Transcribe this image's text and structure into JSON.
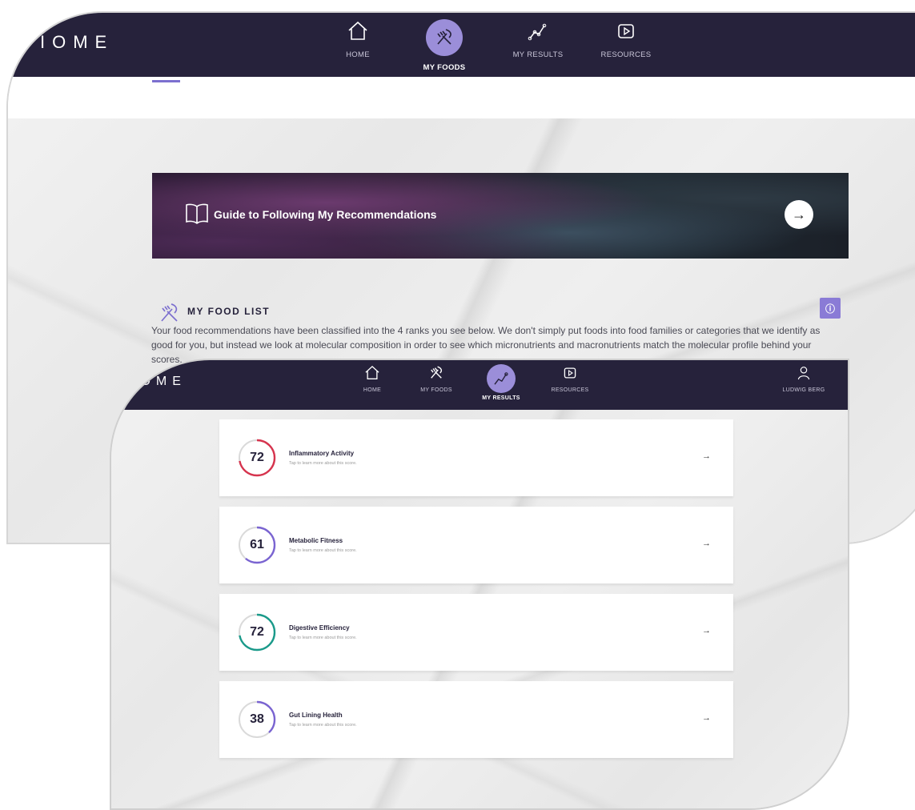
{
  "back_app": {
    "logo": "IOME",
    "nav": [
      {
        "label": "HOME",
        "icon": "home-icon",
        "active": false
      },
      {
        "label": "MY FOODS",
        "icon": "utensils-icon",
        "active": true
      },
      {
        "label": "MY RESULTS",
        "icon": "results-chart-icon",
        "active": false
      },
      {
        "label": "RESOURCES",
        "icon": "play-icon",
        "active": false
      }
    ],
    "banner": {
      "title": "Guide to Following My Recommendations"
    },
    "food_list": {
      "title": "MY FOOD LIST",
      "description": "Your food recommendations have been classified into the 4 ranks you see below. We don't simply put foods into food families or categories that we identify as good for you, but instead we look at molecular composition in order to see which micronutrients and macronutrients match the molecular profile behind your scores."
    }
  },
  "front_app": {
    "logo": "IOME",
    "nav": [
      {
        "label": "HOME",
        "icon": "home-icon",
        "active": false
      },
      {
        "label": "MY FOODS",
        "icon": "utensils-icon",
        "active": false
      },
      {
        "label": "MY RESULTS",
        "icon": "results-chart-icon",
        "active": true
      },
      {
        "label": "RESOURCES",
        "icon": "play-icon",
        "active": false
      }
    ],
    "user": {
      "name": "LUDWIG BERG",
      "icon": "user-icon"
    },
    "scores": [
      {
        "value": "72",
        "percent": 72,
        "title": "Inflammatory Activity",
        "subtitle": "Tap to learn more about this score.",
        "color": "#d6344e"
      },
      {
        "value": "61",
        "percent": 61,
        "title": "Metabolic Fitness",
        "subtitle": "Tap to learn more about this score.",
        "color": "#7a64d1"
      },
      {
        "value": "72",
        "percent": 72,
        "title": "Digestive Efficiency",
        "subtitle": "Tap to learn more about this score.",
        "color": "#1a9a8a"
      },
      {
        "value": "38",
        "percent": 38,
        "title": "Gut Lining Health",
        "subtitle": "Tap to learn more about this score.",
        "color": "#7a64d1"
      }
    ]
  },
  "colors": {
    "nav_bg": "#26223b",
    "accent": "#9b8ed9"
  }
}
